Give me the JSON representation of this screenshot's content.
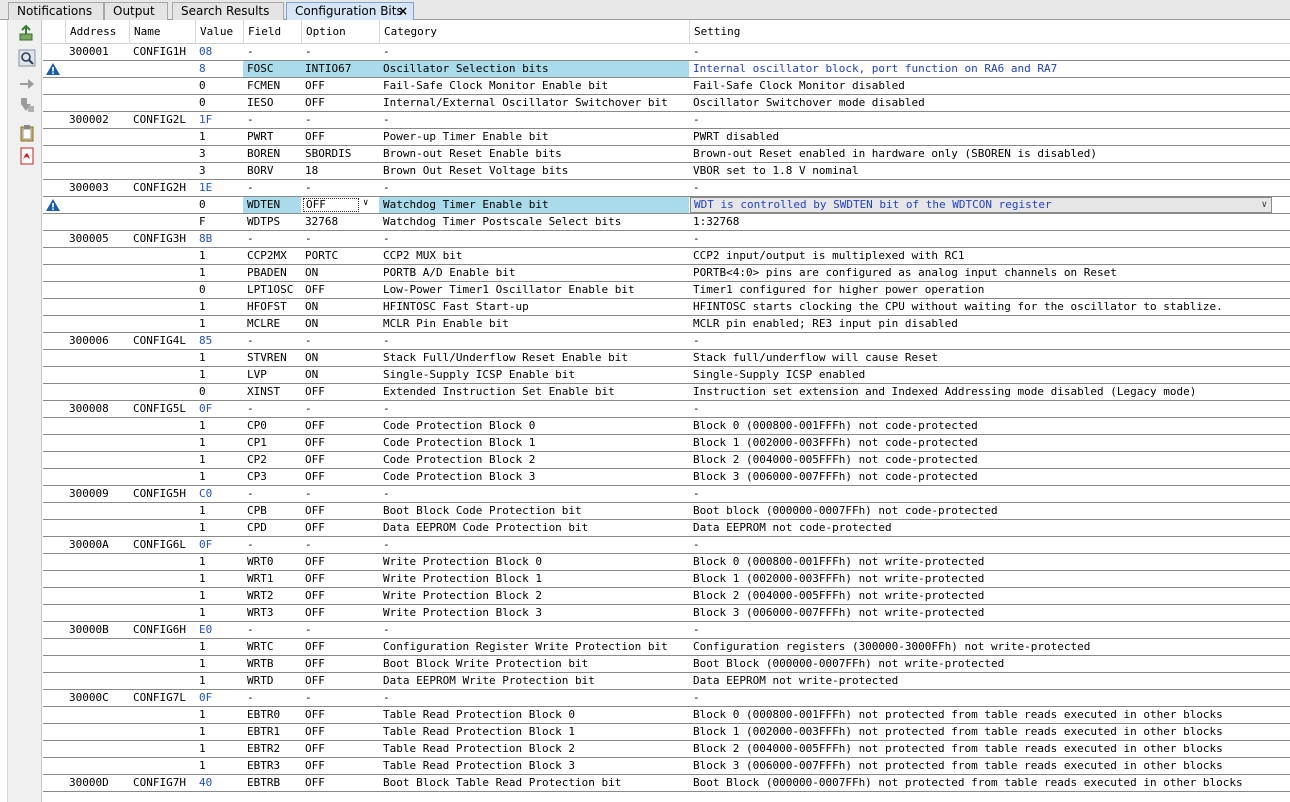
{
  "tabs": [
    {
      "label": "Notifications"
    },
    {
      "label": "Output"
    },
    {
      "label": "Search Results"
    },
    {
      "label": "Configuration Bits",
      "close": "×"
    }
  ],
  "toolbar_icons": [
    "export-icon",
    "search-icon",
    "arrow-right-icon",
    "arrow-down-icon",
    "clipboard-icon",
    "pdf-icon"
  ],
  "columns": [
    "Address",
    "Name",
    "Value",
    "Field",
    "Option",
    "Category",
    "Setting"
  ],
  "colors": {
    "register_value": "#1f4fd0",
    "highlight": "#a9dbea",
    "warning": "#1a5fa8"
  },
  "rows": [
    {
      "type": "reg",
      "address": "300001",
      "name": "CONFIG1H",
      "value": "08",
      "field": "-",
      "option": "-",
      "category": "-",
      "setting": "-"
    },
    {
      "type": "field",
      "value": "8",
      "field": "FOSC",
      "option": "INTIO67",
      "category": "Oscillator Selection bits",
      "setting": "Internal oscillator block, port function on RA6 and RA7",
      "warn": true,
      "highlight": true
    },
    {
      "type": "field",
      "value": "0",
      "field": "FCMEN",
      "option": "OFF",
      "category": "Fail-Safe Clock Monitor Enable bit",
      "setting": "Fail-Safe Clock Monitor disabled"
    },
    {
      "type": "field",
      "value": "0",
      "field": "IESO",
      "option": "OFF",
      "category": "Internal/External Oscillator Switchover bit",
      "setting": "Oscillator Switchover mode disabled"
    },
    {
      "type": "reg",
      "address": "300002",
      "name": "CONFIG2L",
      "value": "1F",
      "field": "-",
      "option": "-",
      "category": "-",
      "setting": "-"
    },
    {
      "type": "field",
      "value": "1",
      "field": "PWRT",
      "option": "OFF",
      "category": "Power-up Timer Enable bit",
      "setting": "PWRT disabled"
    },
    {
      "type": "field",
      "value": "3",
      "field": "BOREN",
      "option": "SBORDIS",
      "category": "Brown-out Reset Enable bits",
      "setting": "Brown-out Reset enabled in hardware only (SBOREN is disabled)"
    },
    {
      "type": "field",
      "value": "3",
      "field": "BORV",
      "option": "18",
      "category": "Brown Out Reset Voltage bits",
      "setting": "VBOR set to 1.8 V nominal"
    },
    {
      "type": "reg",
      "address": "300003",
      "name": "CONFIG2H",
      "value": "1E",
      "field": "-",
      "option": "-",
      "category": "-",
      "setting": "-"
    },
    {
      "type": "field",
      "value": "0",
      "field": "WDTEN",
      "option": "OFF",
      "category": "Watchdog Timer Enable bit",
      "setting": "WDT is controlled by SWDTEN bit of the WDTCON register",
      "warn": true,
      "highlight": true,
      "editing": true
    },
    {
      "type": "field",
      "value": "F",
      "field": "WDTPS",
      "option": "32768",
      "category": "Watchdog Timer Postscale Select bits",
      "setting": "1:32768"
    },
    {
      "type": "reg",
      "address": "300005",
      "name": "CONFIG3H",
      "value": "8B",
      "field": "-",
      "option": "-",
      "category": "-",
      "setting": "-"
    },
    {
      "type": "field",
      "value": "1",
      "field": "CCP2MX",
      "option": "PORTC",
      "category": "CCP2 MUX bit",
      "setting": "CCP2 input/output is multiplexed with RC1"
    },
    {
      "type": "field",
      "value": "1",
      "field": "PBADEN",
      "option": "ON",
      "category": "PORTB A/D Enable bit",
      "setting": "PORTB<4:0> pins are configured as analog input channels on Reset"
    },
    {
      "type": "field",
      "value": "0",
      "field": "LPT1OSC",
      "option": "OFF",
      "category": "Low-Power Timer1 Oscillator Enable bit",
      "setting": "Timer1 configured for higher power operation"
    },
    {
      "type": "field",
      "value": "1",
      "field": "HFOFST",
      "option": "ON",
      "category": "HFINTOSC Fast Start-up",
      "setting": "HFINTOSC starts clocking the CPU without waiting for the oscillator to stablize."
    },
    {
      "type": "field",
      "value": "1",
      "field": "MCLRE",
      "option": "ON",
      "category": "MCLR Pin Enable bit",
      "setting": "MCLR pin enabled; RE3 input pin disabled"
    },
    {
      "type": "reg",
      "address": "300006",
      "name": "CONFIG4L",
      "value": "85",
      "field": "-",
      "option": "-",
      "category": "-",
      "setting": "-"
    },
    {
      "type": "field",
      "value": "1",
      "field": "STVREN",
      "option": "ON",
      "category": "Stack Full/Underflow Reset Enable bit",
      "setting": "Stack full/underflow will cause Reset"
    },
    {
      "type": "field",
      "value": "1",
      "field": "LVP",
      "option": "ON",
      "category": "Single-Supply ICSP Enable bit",
      "setting": "Single-Supply ICSP enabled"
    },
    {
      "type": "field",
      "value": "0",
      "field": "XINST",
      "option": "OFF",
      "category": "Extended Instruction Set Enable bit",
      "setting": "Instruction set extension and Indexed Addressing mode disabled (Legacy mode)"
    },
    {
      "type": "reg",
      "address": "300008",
      "name": "CONFIG5L",
      "value": "0F",
      "field": "-",
      "option": "-",
      "category": "-",
      "setting": "-"
    },
    {
      "type": "field",
      "value": "1",
      "field": "CP0",
      "option": "OFF",
      "category": "Code Protection Block 0",
      "setting": "Block 0 (000800-001FFFh) not code-protected"
    },
    {
      "type": "field",
      "value": "1",
      "field": "CP1",
      "option": "OFF",
      "category": "Code Protection Block 1",
      "setting": "Block 1 (002000-003FFFh) not code-protected"
    },
    {
      "type": "field",
      "value": "1",
      "field": "CP2",
      "option": "OFF",
      "category": "Code Protection Block 2",
      "setting": "Block 2 (004000-005FFFh) not code-protected"
    },
    {
      "type": "field",
      "value": "1",
      "field": "CP3",
      "option": "OFF",
      "category": "Code Protection Block 3",
      "setting": "Block 3 (006000-007FFFh) not code-protected"
    },
    {
      "type": "reg",
      "address": "300009",
      "name": "CONFIG5H",
      "value": "C0",
      "field": "-",
      "option": "-",
      "category": "-",
      "setting": "-"
    },
    {
      "type": "field",
      "value": "1",
      "field": "CPB",
      "option": "OFF",
      "category": "Boot Block Code Protection bit",
      "setting": "Boot block (000000-0007FFh) not code-protected"
    },
    {
      "type": "field",
      "value": "1",
      "field": "CPD",
      "option": "OFF",
      "category": "Data EEPROM Code Protection bit",
      "setting": "Data EEPROM not code-protected"
    },
    {
      "type": "reg",
      "address": "30000A",
      "name": "CONFIG6L",
      "value": "0F",
      "field": "-",
      "option": "-",
      "category": "-",
      "setting": "-"
    },
    {
      "type": "field",
      "value": "1",
      "field": "WRT0",
      "option": "OFF",
      "category": "Write Protection Block 0",
      "setting": "Block 0 (000800-001FFFh) not write-protected"
    },
    {
      "type": "field",
      "value": "1",
      "field": "WRT1",
      "option": "OFF",
      "category": "Write Protection Block 1",
      "setting": "Block 1 (002000-003FFFh) not write-protected"
    },
    {
      "type": "field",
      "value": "1",
      "field": "WRT2",
      "option": "OFF",
      "category": "Write Protection Block 2",
      "setting": "Block 2 (004000-005FFFh) not write-protected"
    },
    {
      "type": "field",
      "value": "1",
      "field": "WRT3",
      "option": "OFF",
      "category": "Write Protection Block 3",
      "setting": "Block 3 (006000-007FFFh) not write-protected"
    },
    {
      "type": "reg",
      "address": "30000B",
      "name": "CONFIG6H",
      "value": "E0",
      "field": "-",
      "option": "-",
      "category": "-",
      "setting": "-"
    },
    {
      "type": "field",
      "value": "1",
      "field": "WRTC",
      "option": "OFF",
      "category": "Configuration Register Write Protection bit",
      "setting": "Configuration registers (300000-3000FFh) not write-protected"
    },
    {
      "type": "field",
      "value": "1",
      "field": "WRTB",
      "option": "OFF",
      "category": "Boot Block Write Protection bit",
      "setting": "Boot Block (000000-0007FFh) not write-protected"
    },
    {
      "type": "field",
      "value": "1",
      "field": "WRTD",
      "option": "OFF",
      "category": "Data EEPROM Write Protection bit",
      "setting": "Data EEPROM not write-protected"
    },
    {
      "type": "reg",
      "address": "30000C",
      "name": "CONFIG7L",
      "value": "0F",
      "field": "-",
      "option": "-",
      "category": "-",
      "setting": "-"
    },
    {
      "type": "field",
      "value": "1",
      "field": "EBTR0",
      "option": "OFF",
      "category": "Table Read Protection Block 0",
      "setting": "Block 0 (000800-001FFFh) not protected from table reads executed in other blocks"
    },
    {
      "type": "field",
      "value": "1",
      "field": "EBTR1",
      "option": "OFF",
      "category": "Table Read Protection Block 1",
      "setting": "Block 1 (002000-003FFFh) not protected from table reads executed in other blocks"
    },
    {
      "type": "field",
      "value": "1",
      "field": "EBTR2",
      "option": "OFF",
      "category": "Table Read Protection Block 2",
      "setting": "Block 2 (004000-005FFFh) not protected from table reads executed in other blocks"
    },
    {
      "type": "field",
      "value": "1",
      "field": "EBTR3",
      "option": "OFF",
      "category": "Table Read Protection Block 3",
      "setting": "Block 3 (006000-007FFFh) not protected from table reads executed in other blocks"
    },
    {
      "type": "reg",
      "address": "30000D",
      "name": "CONFIG7H",
      "value": "40",
      "field": "EBTRB",
      "option": "OFF",
      "category": "Boot Block Table Read Protection bit",
      "setting": "Boot Block (000000-0007FFh) not protected from table reads executed in other blocks"
    }
  ]
}
